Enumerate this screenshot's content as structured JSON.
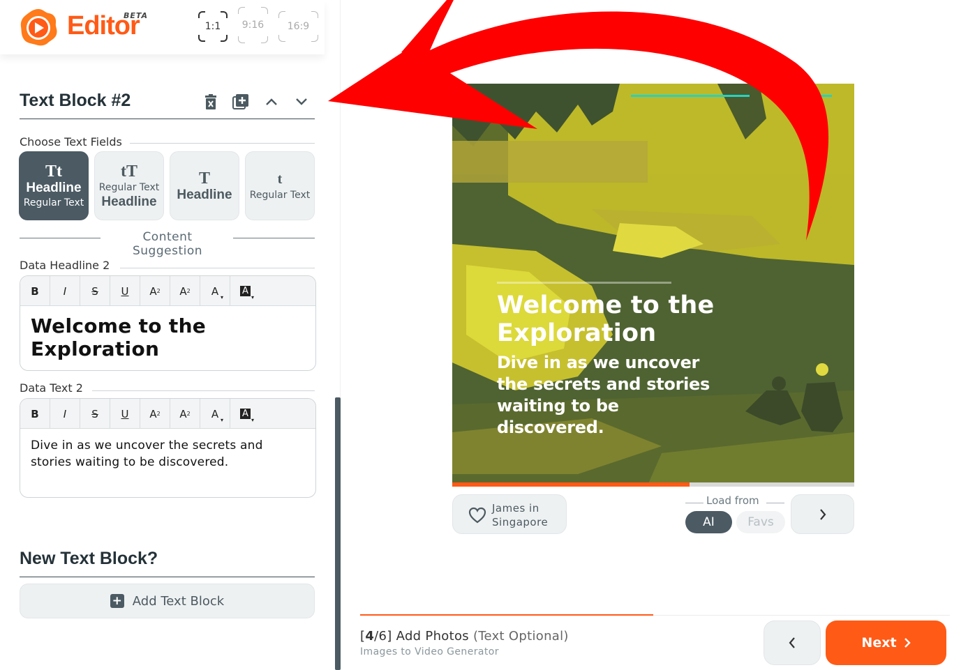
{
  "app": {
    "logo_text": "Editor",
    "beta_label": "BETA",
    "brand_color": "#ff5a16"
  },
  "aspect_ratios": [
    {
      "label": "1:1",
      "selected": true
    },
    {
      "label": "9:16",
      "selected": false
    },
    {
      "label": "16:9",
      "selected": false
    }
  ],
  "text_block": {
    "title": "Text Block #2"
  },
  "choose_fields": {
    "label": "Choose Text Fields",
    "options": [
      {
        "glyph": "Tt",
        "line1": "Headline",
        "line2": "Regular Text",
        "active": true
      },
      {
        "glyph": "tT",
        "line1": "Regular Text",
        "line2": "Headline",
        "active": false
      },
      {
        "glyph": "T",
        "line1": "Headline",
        "line2": "",
        "active": false
      },
      {
        "glyph": "t",
        "line1": "Regular Text",
        "line2": "",
        "active": false
      }
    ]
  },
  "content_suggestion": "Content Suggestion",
  "headline_field": {
    "label": "Data Headline 2",
    "value": "Welcome to the Exploration"
  },
  "text_field": {
    "label": "Data Text 2",
    "value": "Dive in as we uncover the secrets and stories waiting to be discovered."
  },
  "toolbar": [
    "B",
    "I",
    "S",
    "U",
    "A",
    "A",
    "A",
    "A"
  ],
  "new_block": {
    "title": "New Text Block?",
    "button": "Add Text Block"
  },
  "preview": {
    "headline": "Welcome to the Exploration",
    "text": "Dive in as we uncover the secrets and stories waiting to be discovered.",
    "progress": 0.59
  },
  "credit": {
    "name_line1": "James in",
    "name_line2": "Singapore"
  },
  "load_from": {
    "label": "Load from",
    "options": [
      {
        "label": "AI",
        "active": true
      },
      {
        "label": "Favs",
        "active": false
      }
    ]
  },
  "footer": {
    "step_current": "4",
    "step_total": "6",
    "step_title": "Add Photos",
    "step_note": "(Text Optional)",
    "subtitle": "Images to Video Generator",
    "next_label": "Next",
    "progress": 0.5
  },
  "colors": {
    "dark": "#4b5a63",
    "accent": "#ff5a16",
    "teal": "#22d4c4"
  }
}
